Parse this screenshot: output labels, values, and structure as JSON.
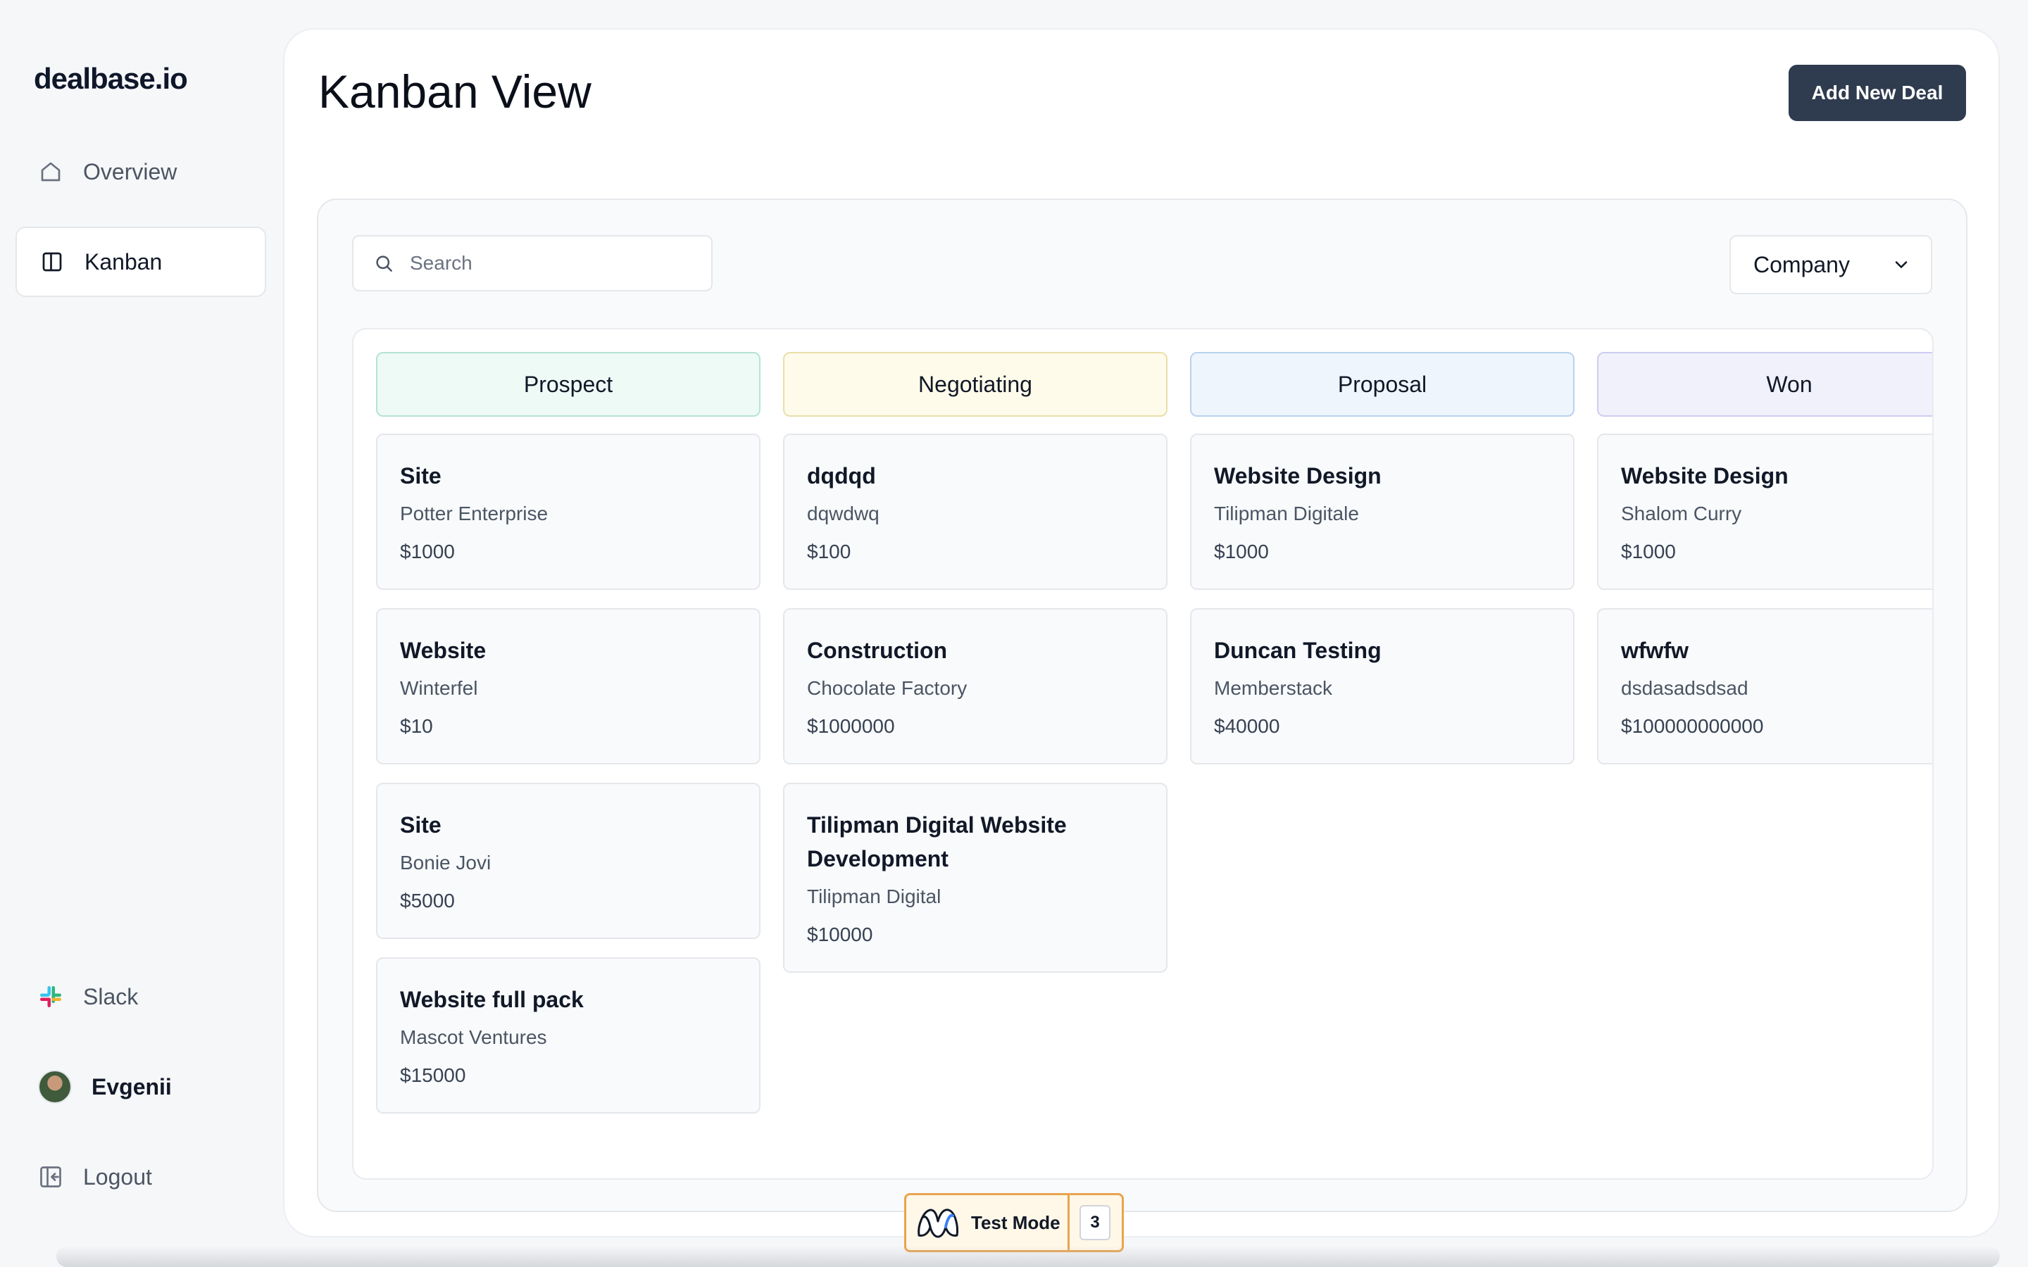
{
  "brand": "dealbase.io",
  "nav": {
    "overview": "Overview",
    "kanban": "Kanban",
    "slack": "Slack",
    "user": "Evgenii",
    "logout": "Logout"
  },
  "page": {
    "title": "Kanban View",
    "add_button": "Add New Deal"
  },
  "search": {
    "placeholder": "Search",
    "value": ""
  },
  "group_select": {
    "value": "Company"
  },
  "columns": [
    {
      "name": "Prospect",
      "bg": "#edfaf6",
      "border": "#b4e4d2",
      "cards": [
        {
          "title": "Site",
          "company": "Potter Enterprise",
          "amount": "$1000"
        },
        {
          "title": "Website",
          "company": "Winterfel",
          "amount": "$10"
        },
        {
          "title": "Site",
          "company": "Bonie Jovi",
          "amount": "$5000"
        },
        {
          "title": "Website full pack",
          "company": "Mascot Ventures",
          "amount": "$15000"
        }
      ]
    },
    {
      "name": "Negotiating",
      "bg": "#fefbea",
      "border": "#e9dfa9",
      "cards": [
        {
          "title": "dqdqd",
          "company": "dqwdwq",
          "amount": "$100"
        },
        {
          "title": "Construction",
          "company": "Chocolate Factory",
          "amount": "$1000000"
        },
        {
          "title": "Tilipman Digital Website Development",
          "company": "Tilipman Digital",
          "amount": "$10000"
        }
      ]
    },
    {
      "name": "Proposal",
      "bg": "#eef5fd",
      "border": "#b9d2ee",
      "cards": [
        {
          "title": "Website Design",
          "company": "Tilipman Digitale",
          "amount": "$1000"
        },
        {
          "title": "Duncan Testing",
          "company": "Memberstack",
          "amount": "$40000"
        }
      ]
    },
    {
      "name": "Won",
      "bg": "#f1f1fc",
      "border": "#cdcdf0",
      "cards": [
        {
          "title": "Website Design",
          "company": "Shalom Curry",
          "amount": "$1000"
        },
        {
          "title": "wfwfw",
          "company": "dsdasadsdsad",
          "amount": "$100000000000"
        }
      ]
    }
  ],
  "test_mode": {
    "label": "Test Mode",
    "count": "3"
  },
  "colors": {
    "primary_button": "#2f3b4f",
    "test_mode_border": "#e8a44d"
  },
  "icons": {
    "overview": "home-icon",
    "kanban": "columns-icon",
    "slack": "slack-icon",
    "logout": "logout-icon",
    "search": "search-icon",
    "select": "chevron-down-icon"
  }
}
